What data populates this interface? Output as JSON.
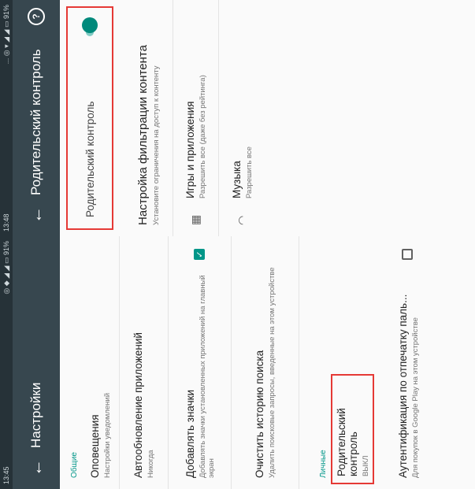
{
  "top": {
    "status": {
      "left": "13:48",
      "right": "... ◎ ▾ ◢ ◢ ▭ 91%"
    },
    "title": "Родительский контроль",
    "toggle_label": "Родительский контроль",
    "items": [
      {
        "title": "Настройка фильтрации контента",
        "subtitle": "Установите ограничения на доступ к контенту"
      },
      {
        "title": "Игры и приложения",
        "subtitle": "Разрешить все (даже без рейтинга)"
      },
      {
        "title": "Музыка",
        "subtitle": "Разрешить все"
      }
    ]
  },
  "bottom": {
    "status": {
      "left": "13:45",
      "right": "◎ ◆ ◢ ◢ ▭ 91%"
    },
    "title": "Настройки",
    "section_general": "Общие",
    "section_personal": "Личные",
    "items": [
      {
        "title": "Оповещения",
        "subtitle": "Настройки уведомлений"
      },
      {
        "title": "Автообновление приложений",
        "subtitle": "Никогда"
      },
      {
        "title": "Добавлять значки",
        "subtitle": "Добавлять значки установленных приложений на главный экран"
      },
      {
        "title": "Очистить историю поиска",
        "subtitle": "Удалить поисковые запросы, введенные на этом устройстве"
      },
      {
        "title": "Родительский контроль",
        "subtitle": "ВЫКЛ"
      },
      {
        "title": "Аутентификация по отпечатку паль...",
        "subtitle": "Для покупок в Google Play на этом устройстве"
      }
    ]
  },
  "colors": {
    "appbar": "#37474f",
    "accent": "#009688",
    "highlight": "#e53935"
  }
}
